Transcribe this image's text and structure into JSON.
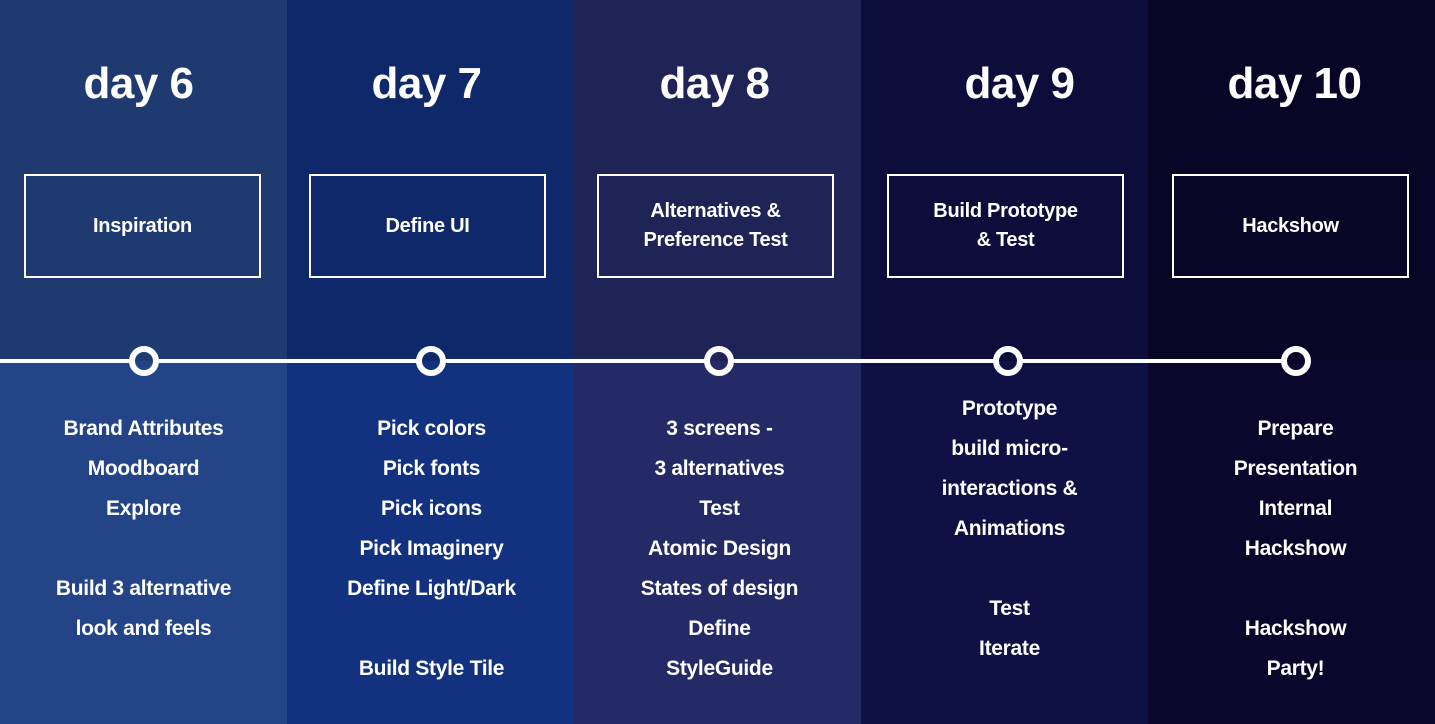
{
  "timeline": {
    "days": [
      {
        "title": "day 6",
        "phase": [
          "Inspiration"
        ],
        "tasks": [
          "Brand Attributes",
          "Moodboard",
          "Explore",
          "",
          "Build 3 alternative",
          "look and feels"
        ]
      },
      {
        "title": "day 7",
        "phase": [
          "Define UI"
        ],
        "tasks": [
          "Pick colors",
          "Pick fonts",
          "Pick icons",
          "Pick Imaginery",
          "Define Light/Dark",
          "",
          "Build Style Tile"
        ]
      },
      {
        "title": "day 8",
        "phase": [
          "Alternatives &",
          "Preference Test"
        ],
        "tasks": [
          "3 screens -",
          "3 alternatives",
          "Test",
          "Atomic Design",
          "States of design",
          "Define",
          "StyleGuide"
        ]
      },
      {
        "title": "day 9",
        "phase": [
          "Build Prototype",
          "& Test"
        ],
        "tasks": [
          "Prototype",
          "build micro-",
          "interactions &",
          "Animations",
          "",
          "Test",
          "Iterate"
        ]
      },
      {
        "title": "day 10",
        "phase": [
          "Hackshow"
        ],
        "tasks": [
          "Prepare",
          "Presentation",
          "Internal",
          "Hackshow",
          "",
          "Hackshow",
          "Party!"
        ]
      }
    ]
  },
  "colors": {
    "text": "#ffffff",
    "line": "#ffffff",
    "columns": [
      {
        "top": "#1f3a70",
        "bottom": "#234487"
      },
      {
        "top": "#0f286a",
        "bottom": "#12317f"
      },
      {
        "top": "#1e2456",
        "bottom": "#232a66"
      },
      {
        "top": "#0c0d3b",
        "bottom": "#0f1044"
      },
      {
        "top": "#080526",
        "bottom": "#0b062b"
      }
    ]
  }
}
